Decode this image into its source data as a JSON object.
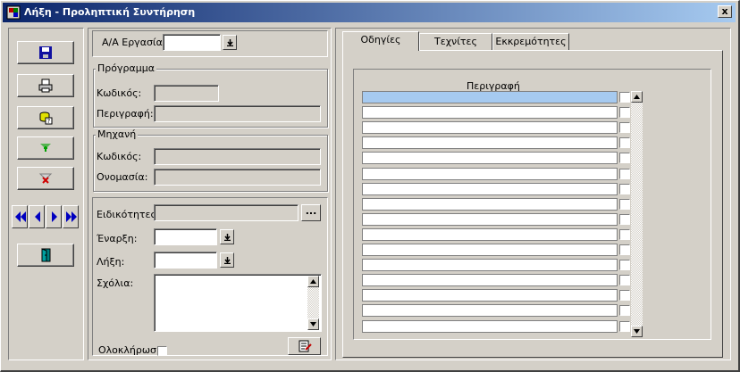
{
  "window": {
    "title": "Λήξη - Προληπτική Συντήρηση",
    "close_label": "x"
  },
  "header": {
    "job_number_label": "Α/Α Εργασίας"
  },
  "program": {
    "group_title": "Πρόγραμμα",
    "code_label": "Κωδικός:",
    "description_label": "Περιγραφή:"
  },
  "machine": {
    "group_title": "Μηχανή",
    "code_label": "Κωδικός:",
    "name_label": "Ονομασία:"
  },
  "details": {
    "specialties_label": "Ειδικότητες:",
    "ellipsis_label": "...",
    "start_label": "Έναρξη:",
    "end_label": "Λήξη:",
    "comments_label": "Σχόλια:",
    "completion_label": "Ολοκλήρωση"
  },
  "tabs": [
    {
      "label": "Οδηγίες",
      "active": true
    },
    {
      "label": "Τεχνίτες",
      "active": false
    },
    {
      "label": "Εκκρεμότητες",
      "active": false
    }
  ],
  "grid": {
    "column_header": "Περιγραφή"
  },
  "icons": {
    "save": "floppy-disk-icon",
    "print": "printer-icon",
    "query": "database-query-icon",
    "add": "add-row-icon",
    "delete": "delete-row-icon",
    "first": "first-record-icon",
    "previous": "previous-record-icon",
    "next": "next-record-icon",
    "last": "last-record-icon",
    "exit": "exit-door-icon",
    "dropdown": "dropdown-arrow-icon",
    "notes": "notes-pen-icon"
  },
  "colors": {
    "title_start": "#0a246a",
    "title_end": "#a6caf0",
    "selection": "#a6caf0",
    "face": "#d4d0c8"
  }
}
